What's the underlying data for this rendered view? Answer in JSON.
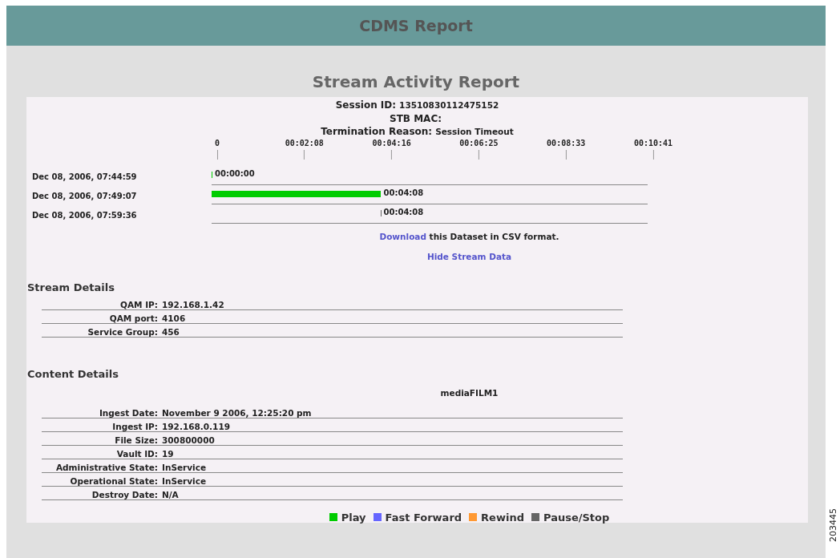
{
  "header": {
    "title": "CDMS Report"
  },
  "report": {
    "title": "Stream Activity Report",
    "session": [
      {
        "label": "Session ID:",
        "value": "13510830112475152"
      },
      {
        "label": "STB MAC:"
      },
      {
        "label": "Termination Reason:",
        "value": "Session Timeout"
      }
    ],
    "axis_ticks": [
      "0",
      "00:02:08",
      "00:04:16",
      "00:06:25",
      "00:08:33",
      "00:10:41"
    ],
    "events": [
      {
        "time": "Dec 08, 2006, 07:44:59",
        "kind": "play",
        "elapsed": "00:00:00"
      },
      {
        "time": "Dec 08, 2006, 07:49:07",
        "kind": "play",
        "level": 0.387,
        "elapsed": "00:04:08"
      },
      {
        "time": "Dec 08, 2006, 07:59:36",
        "kind": "pause",
        "elapsed": "00:04:08"
      }
    ],
    "download": {
      "link": "Download",
      "text": "this Dataset in CSV format."
    },
    "hide_link": "Hide Stream Data",
    "stream_details": {
      "title": "Stream Details",
      "rows": [
        {
          "label": "QAM IP:",
          "value": "192.168.1.42"
        },
        {
          "label": "QAM port:",
          "value": "4106"
        },
        {
          "label": "Service Group:",
          "value": "456"
        }
      ]
    },
    "content_details": {
      "title": "Content Details",
      "name": "mediaFILM1",
      "rows": [
        {
          "label": "Ingest Date:",
          "value": "November 9 2006, 12:25:20 pm"
        },
        {
          "label": "Ingest IP:",
          "value": "192.168.0.119"
        },
        {
          "label": "File Size:",
          "value": "300800000"
        },
        {
          "label": "Vault ID:",
          "value": "19"
        },
        {
          "label": "Administrative State:",
          "value": "InService"
        },
        {
          "label": "Operational State:",
          "value": "InService"
        },
        {
          "label": "Destroy Date:",
          "value": "N/A"
        }
      ]
    },
    "legend": [
      {
        "kind": "play",
        "label": "Play",
        "color": "#00cc00"
      },
      {
        "kind": "fast_forward",
        "label": "Fast Forward",
        "color": "#6666ff"
      },
      {
        "kind": "rewind",
        "label": "Rewind",
        "color": "#ff9933"
      },
      {
        "kind": "pause",
        "label": "Pause/Stop",
        "color": "#666666"
      }
    ]
  },
  "figure_number": "203445"
}
